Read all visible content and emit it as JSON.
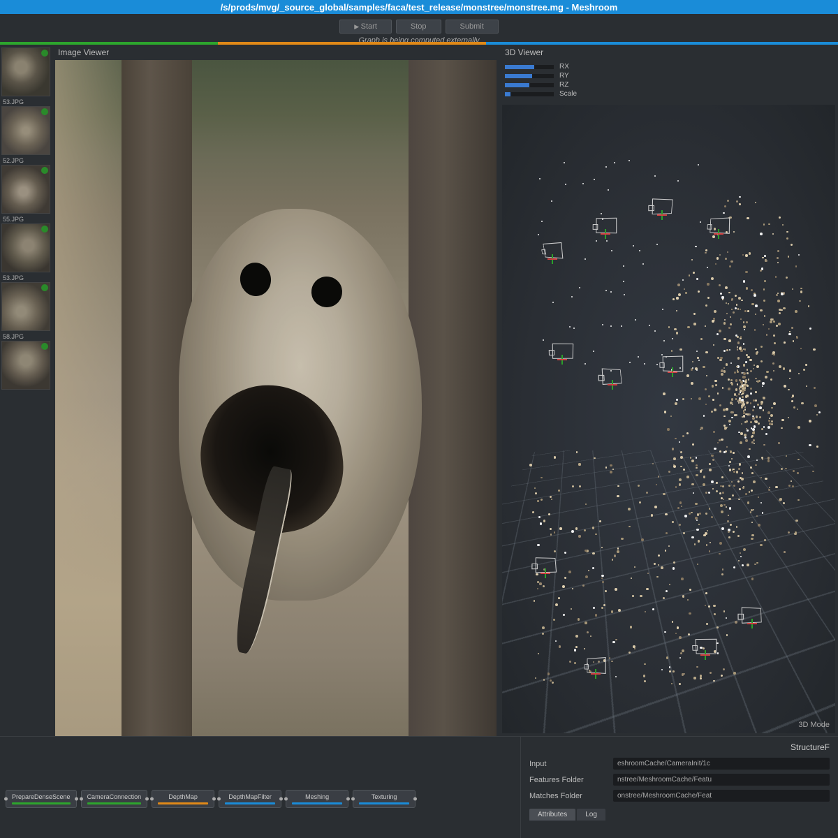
{
  "titlebar": "/s/prods/mvg/_source_global/samples/faca/test_release/monstree/monstree.mg - Meshroom",
  "buttons": {
    "start": "Start",
    "stop": "Stop",
    "submit": "Submit"
  },
  "status": "Graph is being computed externally",
  "panels": {
    "image_viewer": "Image Viewer",
    "viewer_3d": "3D Viewer",
    "mode_3d": "3D Mode"
  },
  "sliders": [
    {
      "label": "RX",
      "value": 60
    },
    {
      "label": "RY",
      "value": 55
    },
    {
      "label": "RZ",
      "value": 50
    },
    {
      "label": "Scale",
      "value": 12
    }
  ],
  "thumbs": [
    {
      "label": "53.JPG"
    },
    {
      "label": "52.JPG"
    },
    {
      "label": "55.JPG"
    },
    {
      "label": "53.JPG"
    },
    {
      "label": "58.JPG"
    },
    {
      "label": ""
    }
  ],
  "nodes": [
    {
      "label": "PrepareDenseScene",
      "bar": "green"
    },
    {
      "label": "CameraConnection",
      "bar": "green"
    },
    {
      "label": "DepthMap",
      "bar": "orange"
    },
    {
      "label": "DepthMapFilter",
      "bar": "blue"
    },
    {
      "label": "Meshing",
      "bar": "blue"
    },
    {
      "label": "Texturing",
      "bar": "blue"
    }
  ],
  "attrs": {
    "title": "StructureF",
    "rows": [
      {
        "label": "Input",
        "value": "eshroomCache/CameraInit/1c"
      },
      {
        "label": "Features Folder",
        "value": "nstree/MeshroomCache/Featu"
      },
      {
        "label": "Matches Folder",
        "value": "onstree/MeshroomCache/Feat"
      }
    ],
    "tabs": {
      "attributes": "Attributes",
      "log": "Log"
    }
  }
}
